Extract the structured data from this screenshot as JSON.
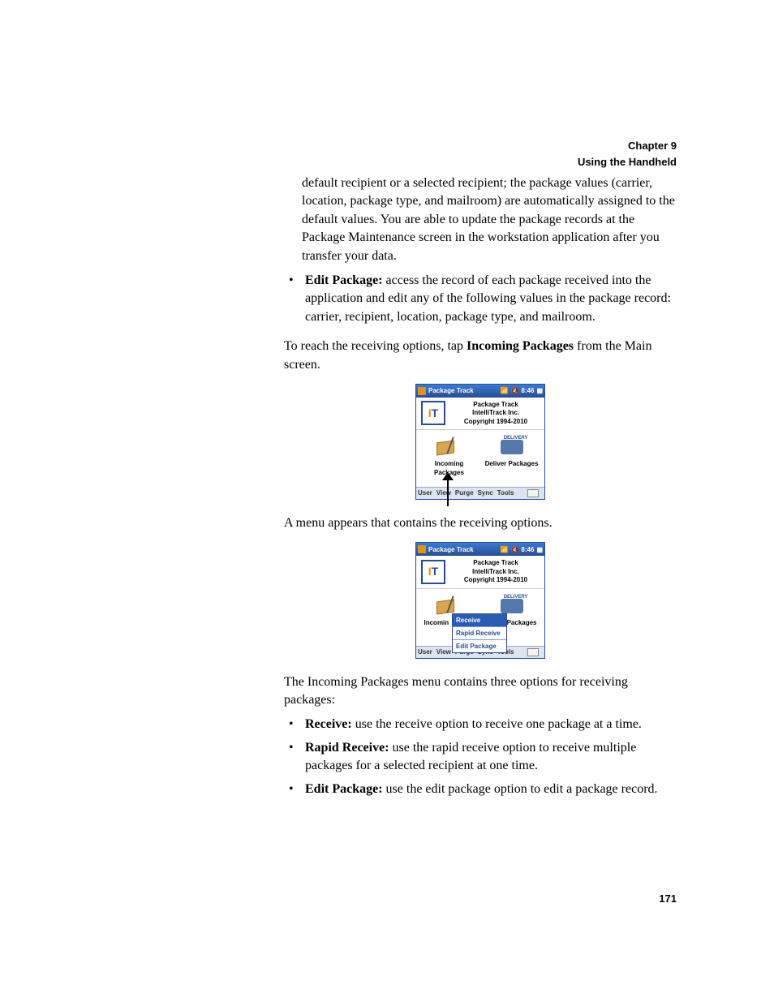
{
  "header": {
    "chapter": "Chapter 9",
    "section": "Using the Handheld"
  },
  "para_intro": "default recipient or a selected recipient; the package values (carrier, location, package type, and mailroom) are automatically assigned to the default values. You are able to update the package records at the Package Maintenance screen in the workstation application after you transfer your data.",
  "bullet_edit_label": "Edit Package:",
  "bullet_edit_text": " access the record of each package received into the application and edit any of the following values in the package record: carrier, recipient, location, package type, and mailroom.",
  "para_reach_a": "To reach the receiving options, tap ",
  "para_reach_b": "Incoming Packages",
  "para_reach_c": " from the Main screen.",
  "para_menu_appears": "A menu appears that contains the receiving options.",
  "para_menu_contains": "The Incoming Packages menu contains three options for receiving packages:",
  "bullets2": {
    "receive_label": "Receive:",
    "receive_text": " use the receive option to receive one package at a time.",
    "rapid_label": "Rapid Receive:",
    "rapid_text": " use the rapid receive option to receive multiple packages for a selected recipient at one time.",
    "edit_label": "Edit Package:",
    "edit_text": " use the edit package option to edit a package record."
  },
  "hh": {
    "title": "Package Track",
    "time": "8:46",
    "splash_line1": "Package Track",
    "splash_line2": "IntelliTrack Inc.",
    "splash_line3": "Copyright 1994-2010",
    "icon_incoming": "Incoming Packages",
    "icon_deliver": "Deliver Packages",
    "icon_incoming_short": "Incomin",
    "icon_deliver_short": "Packages",
    "delivery_badge": "DELIVERY",
    "menu_receive": "Receive",
    "menu_rapid": "Rapid Receive",
    "menu_edit": "Edit Package",
    "bottom": {
      "user": "User",
      "view": "View",
      "purge": "Purge",
      "sync": "Sync",
      "tools": "Tools"
    }
  },
  "page_number": "171"
}
